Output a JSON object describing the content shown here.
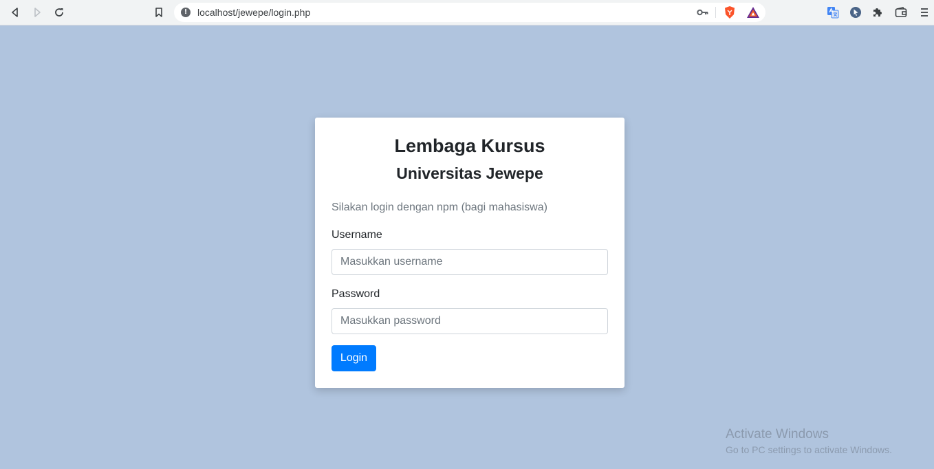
{
  "browser": {
    "url": "localhost/jewepe/login.php",
    "info_icon_glyph": "!",
    "icons": [
      "back-icon",
      "forward-icon",
      "reload-icon",
      "bookmark-icon",
      "key-icon",
      "brave-shields-icon",
      "brave-rewards-icon",
      "translate-icon",
      "extension-cursor-icon",
      "extensions-puzzle-icon",
      "wallet-icon",
      "menu-icon"
    ],
    "brave_color": "#fb542b",
    "accent_color": "#1a73e8"
  },
  "login": {
    "title": "Lembaga Kursus",
    "subtitle": "Universitas Jewepe",
    "hint": "Silakan login dengan npm (bagi mahasiswa)",
    "username_label": "Username",
    "username_placeholder": "Masukkan username",
    "password_label": "Password",
    "password_placeholder": "Masukkan password",
    "submit_label": "Login",
    "button_color": "#007bff"
  },
  "watermark": {
    "title": "Activate Windows",
    "subtitle": "Go to PC settings to activate Windows."
  },
  "page": {
    "background_color": "#b0c4de"
  }
}
